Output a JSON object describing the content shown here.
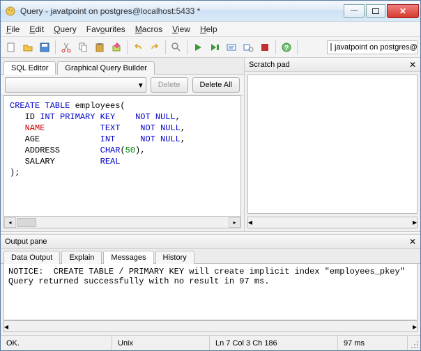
{
  "window": {
    "title": "Query - javatpoint on postgres@localhost:5433 *"
  },
  "menu": {
    "file": "File",
    "edit": "Edit",
    "query": "Query",
    "favourites": "Favourites",
    "macros": "Macros",
    "view": "View",
    "help": "Help"
  },
  "db_combo": "javatpoint on postgres@lo",
  "editor": {
    "tabs": {
      "sql": "SQL Editor",
      "gqb": "Graphical Query Builder"
    },
    "delete": "Delete",
    "delete_all": "Delete All",
    "code_tokens": [
      {
        "t": "kw",
        "v": "CREATE TABLE"
      },
      {
        "t": "tx",
        "v": " employees(\n   ID "
      },
      {
        "t": "ty",
        "v": "INT"
      },
      {
        "t": "tx",
        "v": " "
      },
      {
        "t": "kw",
        "v": "PRIMARY KEY"
      },
      {
        "t": "tx",
        "v": "    "
      },
      {
        "t": "kw",
        "v": "NOT NULL"
      },
      {
        "t": "tx",
        "v": ",\n   "
      },
      {
        "t": "nm",
        "v": "NAME"
      },
      {
        "t": "tx",
        "v": "           "
      },
      {
        "t": "ty",
        "v": "TEXT"
      },
      {
        "t": "tx",
        "v": "    "
      },
      {
        "t": "kw",
        "v": "NOT NULL"
      },
      {
        "t": "tx",
        "v": ",\n   AGE            "
      },
      {
        "t": "ty",
        "v": "INT"
      },
      {
        "t": "tx",
        "v": "     "
      },
      {
        "t": "kw",
        "v": "NOT NULL"
      },
      {
        "t": "tx",
        "v": ",\n   ADDRESS        "
      },
      {
        "t": "ty",
        "v": "CHAR"
      },
      {
        "t": "tx",
        "v": "("
      },
      {
        "t": "nu",
        "v": "50"
      },
      {
        "t": "tx",
        "v": "),\n   SALARY         "
      },
      {
        "t": "ty",
        "v": "REAL"
      },
      {
        "t": "tx",
        "v": "\n);"
      }
    ]
  },
  "scratch": {
    "title": "Scratch pad"
  },
  "output": {
    "title": "Output pane",
    "tabs": {
      "data": "Data Output",
      "explain": "Explain",
      "messages": "Messages",
      "history": "History"
    },
    "text": "NOTICE:  CREATE TABLE / PRIMARY KEY will create implicit index \"employees_pkey\"\nQuery returned successfully with no result in 97 ms."
  },
  "status": {
    "ok": "OK.",
    "encoding": "Unix",
    "position": "Ln 7 Col 3 Ch 186",
    "time": "97 ms"
  }
}
